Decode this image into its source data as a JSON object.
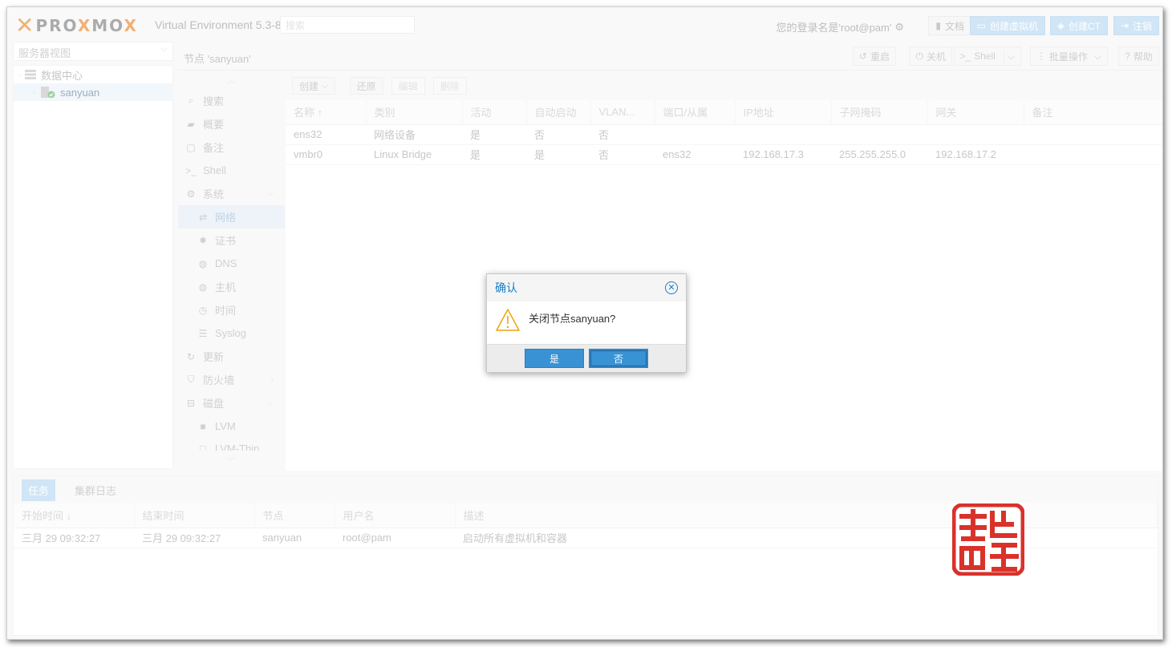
{
  "topbar": {
    "brand": "PROXMOX",
    "brand_part1": "PRO",
    "brand_part2": "X",
    "brand_part3": "MO",
    "brand_part4": "X",
    "product": "Virtual Environment 5.3-8",
    "search_placeholder": "搜索",
    "login_text": "您的登录名是'root@pam'",
    "docs_label": "文档",
    "create_vm_label": "创建虚拟机",
    "create_ct_label": "创建CT",
    "logout_label": "注销"
  },
  "view_selector": {
    "value": "服务器视图"
  },
  "tree": {
    "datacenter": "数据中心",
    "node": "sanyuan"
  },
  "node_header": {
    "title": "节点 'sanyuan'",
    "restart": "重启",
    "shutdown": "关机",
    "shell": "Shell",
    "bulk": "批量操作",
    "help": "帮助"
  },
  "menu": {
    "items": [
      {
        "label": "搜索",
        "icon": "search-icon"
      },
      {
        "label": "概要",
        "icon": "book-icon"
      },
      {
        "label": "备注",
        "icon": "note-icon"
      },
      {
        "label": "Shell",
        "icon": "terminal-icon"
      },
      {
        "label": "系统",
        "icon": "cogs-icon"
      },
      {
        "label": "网络",
        "icon": "exchange-icon"
      },
      {
        "label": "证书",
        "icon": "certificate-icon"
      },
      {
        "label": "DNS",
        "icon": "globe-icon"
      },
      {
        "label": "主机",
        "icon": "globe-icon"
      },
      {
        "label": "时间",
        "icon": "clock-icon"
      },
      {
        "label": "Syslog",
        "icon": "list-icon"
      },
      {
        "label": "更新",
        "icon": "refresh-icon"
      },
      {
        "label": "防火墙",
        "icon": "shield-icon"
      },
      {
        "label": "磁盘",
        "icon": "drive-icon"
      },
      {
        "label": "LVM",
        "icon": "square-icon"
      },
      {
        "label": "LVM-Thin",
        "icon": "square-icon"
      }
    ]
  },
  "network": {
    "toolbar": {
      "create": "创建",
      "revert": "还原",
      "edit": "编辑",
      "remove": "删除"
    },
    "columns": [
      "名称 ↑",
      "类别",
      "活动",
      "自动启动",
      "VLAN...",
      "端口/从属",
      "IP地址",
      "子网掩码",
      "网关",
      "备注"
    ],
    "rows": [
      [
        "ens32",
        "网络设备",
        "是",
        "否",
        "否",
        "",
        "",
        "",
        "",
        ""
      ],
      [
        "vmbr0",
        "Linux Bridge",
        "是",
        "是",
        "否",
        "ens32",
        "192.168.17.3",
        "255.255.255.0",
        "192.168.17.2",
        ""
      ]
    ]
  },
  "bottom": {
    "tabs": [
      "任务",
      "集群日志"
    ],
    "columns": [
      "开始时间 ↓",
      "结束时间",
      "节点",
      "用户名",
      "描述"
    ],
    "rows": [
      [
        "三月 29 09:32:27",
        "三月 29 09:32:27",
        "sanyuan",
        "root@pam",
        "启动所有虚拟机和容器"
      ]
    ]
  },
  "dialog": {
    "title": "确认",
    "message": "关闭节点sanyuan?",
    "yes": "是",
    "no": "否"
  },
  "colors": {
    "accent": "#157fcc",
    "brand": "#e57000",
    "seal": "#d9322b"
  }
}
